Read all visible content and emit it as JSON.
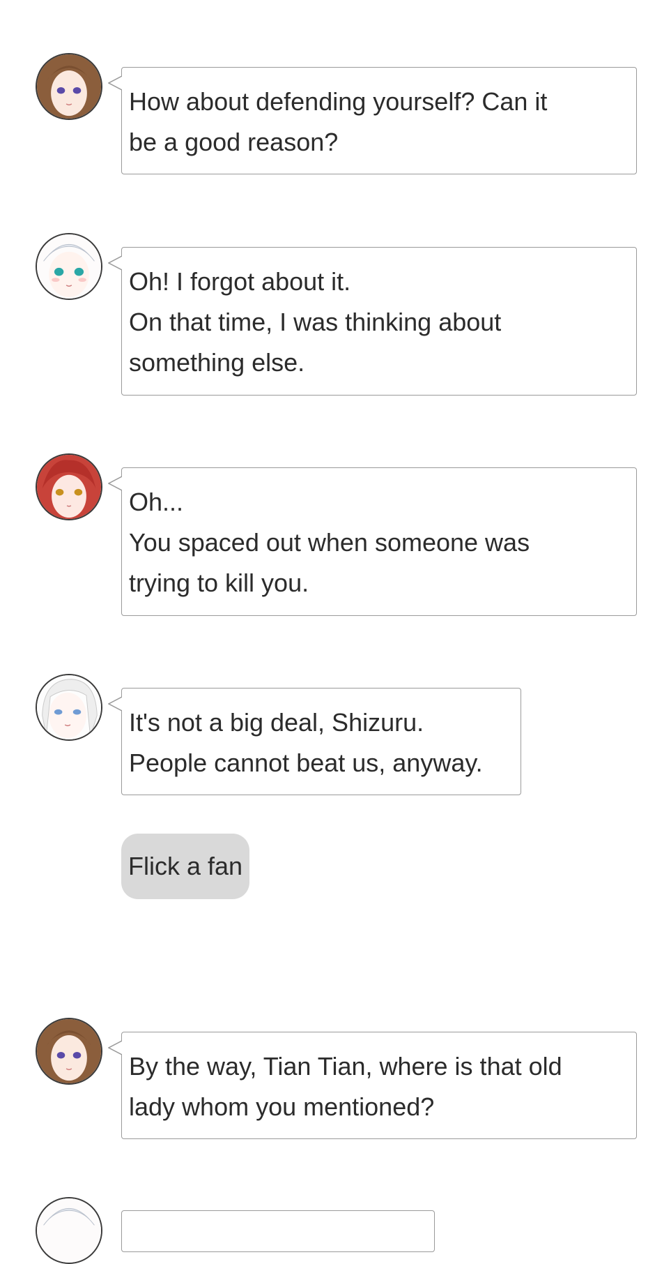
{
  "messages": [
    {
      "speaker": "brown-hair-girl",
      "lines": [
        "How about defending yourself? Can it",
        "be a good reason?"
      ]
    },
    {
      "speaker": "white-hair-teal-eyes-girl",
      "lines": [
        "Oh! I forgot about it.",
        "On that time, I was thinking about",
        "something else."
      ]
    },
    {
      "speaker": "red-hair-girl",
      "lines": [
        "Oh...",
        "You spaced out when someone was",
        "trying to kill you."
      ]
    },
    {
      "speaker": "white-hair-blue-eyes-girl",
      "lines": [
        "It's not a big deal, Shizuru.",
        "People cannot beat us, anyway."
      ]
    },
    {
      "speaker": "brown-hair-girl",
      "lines": [
        "By the way, Tian Tian, where is that old",
        "lady whom you mentioned?"
      ]
    }
  ],
  "choice": {
    "label": "Flick a fan"
  },
  "colors": {
    "bubble_border": "#9a9a9a",
    "choice_bg": "#d9d9d9",
    "text": "#2b2b2b"
  }
}
